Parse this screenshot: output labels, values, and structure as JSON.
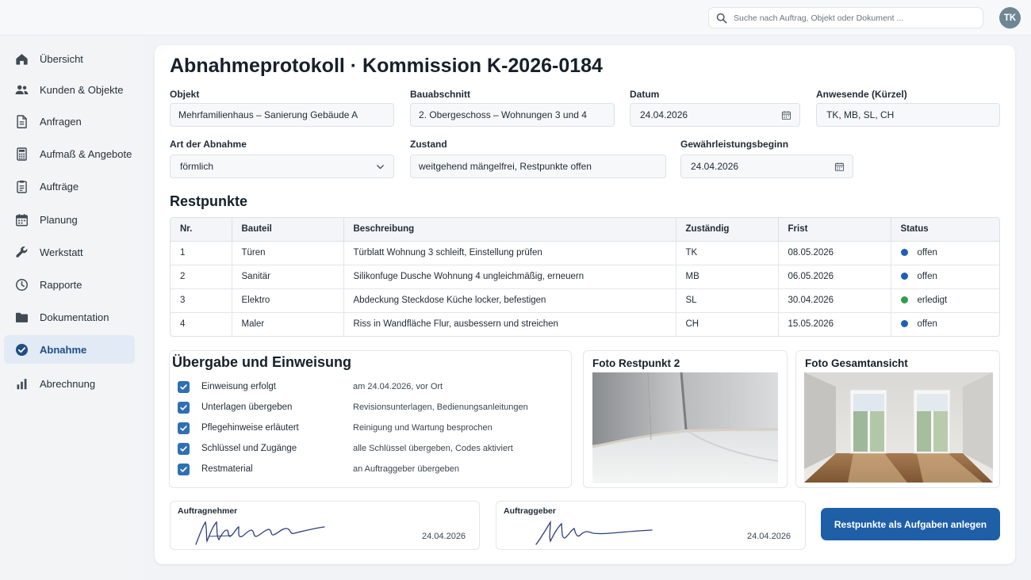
{
  "search": {
    "placeholder": "Suche nach Auftrag, Objekt oder Dokument ..."
  },
  "user": {
    "initials": "TK"
  },
  "sidebar": {
    "items": [
      {
        "label": "Übersicht",
        "icon": "home-icon"
      },
      {
        "label": "Kunden & Objekte",
        "icon": "users-icon"
      },
      {
        "label": "Anfragen",
        "icon": "document-icon"
      },
      {
        "label": "Aufmaß & Angebote",
        "icon": "calculator-icon"
      },
      {
        "label": "Aufträge",
        "icon": "clipboard-icon"
      },
      {
        "label": "Planung",
        "icon": "calendar-icon"
      },
      {
        "label": "Werkstatt",
        "icon": "wrench-icon"
      },
      {
        "label": "Rapporte",
        "icon": "clock-icon"
      },
      {
        "label": "Dokumentation",
        "icon": "folder-icon"
      },
      {
        "label": "Abnahme",
        "icon": "check-circle-icon",
        "active": true
      },
      {
        "label": "Abrechnung",
        "icon": "bar-chart-icon"
      }
    ]
  },
  "page": {
    "title": "Abnahmeprotokoll · Kommission K-2026-0184"
  },
  "form": {
    "objekt": {
      "label": "Objekt",
      "value": "Mehrfamilienhaus – Sanierung Gebäude A"
    },
    "bauabschnitt": {
      "label": "Bauabschnitt",
      "value": "2. Obergeschoss – Wohnungen 3 und 4"
    },
    "datum": {
      "label": "Datum",
      "value": "24.04.2026"
    },
    "anwesende": {
      "label": "Anwesende (Kürzel)",
      "value": "TK, MB, SL, CH"
    },
    "art": {
      "label": "Art der Abnahme",
      "value": "förmlich"
    },
    "zustand": {
      "label": "Zustand",
      "value": "weitgehend mängelfrei, Restpunkte offen"
    },
    "gewaehrleistung": {
      "label": "Gewährleistungsbeginn",
      "value": "24.04.2026"
    }
  },
  "restpunkte": {
    "title": "Restpunkte",
    "columns": [
      "Nr.",
      "Bauteil",
      "Beschreibung",
      "Zuständig",
      "Frist",
      "Status"
    ],
    "rows": [
      {
        "nr": "1",
        "bauteil": "Türen",
        "beschreibung": "Türblatt Wohnung 3 schleift, Einstellung prüfen",
        "zustaendig": "TK",
        "frist": "08.05.2026",
        "status": "offen",
        "status_color": "#1f5fb0"
      },
      {
        "nr": "2",
        "bauteil": "Sanitär",
        "beschreibung": "Silikonfuge Dusche Wohnung 4 ungleichmäßig, erneuern",
        "zustaendig": "MB",
        "frist": "06.05.2026",
        "status": "offen",
        "status_color": "#1f5fb0"
      },
      {
        "nr": "3",
        "bauteil": "Elektro",
        "beschreibung": "Abdeckung Steckdose Küche locker, befestigen",
        "zustaendig": "SL",
        "frist": "30.04.2026",
        "status": "erledigt",
        "status_color": "#2e9e48"
      },
      {
        "nr": "4",
        "bauteil": "Maler",
        "beschreibung": "Riss in Wandfläche Flur, ausbessern und streichen",
        "zustaendig": "CH",
        "frist": "15.05.2026",
        "status": "offen",
        "status_color": "#1f5fb0"
      }
    ]
  },
  "uebergabe": {
    "title": "Übergabe und Einweisung",
    "items": [
      {
        "label": "Einweisung erfolgt",
        "note": "am 24.04.2026, vor Ort",
        "checked": true
      },
      {
        "label": "Unterlagen übergeben",
        "note": "Revisionsunterlagen, Bedienungsanleitungen",
        "checked": true
      },
      {
        "label": "Pflegehinweise erläutert",
        "note": "Reinigung und Wartung besprochen",
        "checked": true
      },
      {
        "label": "Schlüssel und Zugänge",
        "note": "alle Schlüssel übergeben, Codes aktiviert",
        "checked": true
      },
      {
        "label": "Restmaterial",
        "note": "an Auftraggeber übergeben",
        "checked": true
      }
    ]
  },
  "photos": {
    "restpunkt": {
      "title": "Foto Restpunkt 2"
    },
    "gesamt": {
      "title": "Foto Gesamtansicht"
    }
  },
  "signatures": {
    "auftragnehmer": {
      "label": "Auftragnehmer",
      "date": "24.04.2026"
    },
    "auftraggeber": {
      "label": "Auftraggeber",
      "date": "24.04.2026"
    }
  },
  "actions": {
    "create_tasks": "Restpunkte als Aufgaben anlegen"
  },
  "colors": {
    "accent": "#1f5fa8",
    "active_nav_bg": "#e1eaf5",
    "offen": "#1f5fb0",
    "erledigt": "#2e9e48"
  }
}
